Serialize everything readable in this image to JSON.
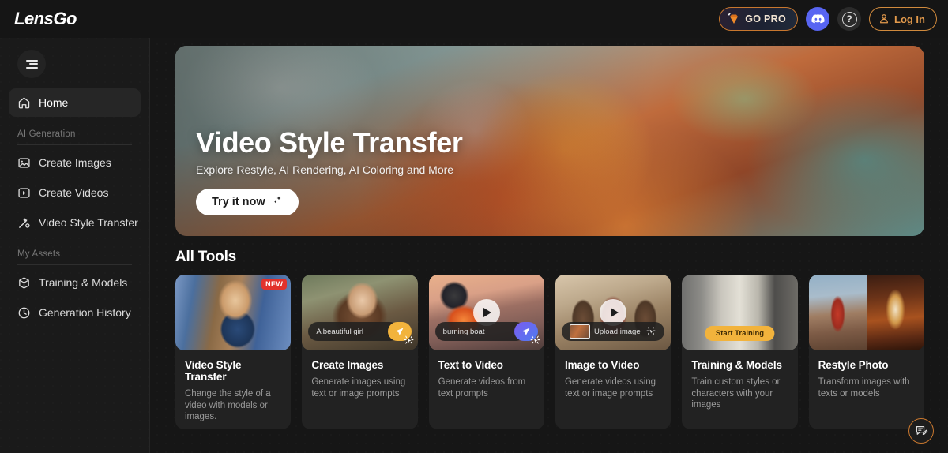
{
  "header": {
    "logo": "LensGo",
    "go_pro_label": "GO PRO",
    "login_label": "Log In",
    "discord_icon": "discord-icon",
    "help_icon": "question-mark-icon",
    "gem_icon": "diamond-gem-icon",
    "user_icon": "person-icon",
    "accent_orange": "#e39a4c",
    "discord_blue": "#5865f2"
  },
  "sidebar": {
    "menu_toggle_icon": "hamburger-menu-icon",
    "home": {
      "label": "Home",
      "icon": "home-icon",
      "active": true
    },
    "sections": [
      {
        "title": "AI Generation",
        "items": [
          {
            "label": "Create Images",
            "icon": "image-icon"
          },
          {
            "label": "Create Videos",
            "icon": "video-play-icon"
          },
          {
            "label": "Video Style Transfer",
            "icon": "magic-wand-icon"
          }
        ]
      },
      {
        "title": "My Assets",
        "items": [
          {
            "label": "Training & Models",
            "icon": "cube-icon"
          },
          {
            "label": "Generation History",
            "icon": "clock-icon"
          }
        ]
      }
    ]
  },
  "hero": {
    "title": "Video Style Transfer",
    "subtitle": "Explore Restyle, AI Rendering, AI Coloring and More",
    "cta_label": "Try it now",
    "cta_icon": "sparkle-icon"
  },
  "tools": {
    "heading": "All Tools",
    "cards": [
      {
        "title": "Video Style Transfer",
        "desc": "Change the style of a video with models or images.",
        "badge": "NEW",
        "thumb_class": "tn-vangogh",
        "overlay": "none"
      },
      {
        "title": "Create Images",
        "desc": "Generate images using text or image prompts",
        "badge": null,
        "thumb_class": "tn-girl",
        "overlay": "prompt",
        "prompt_text": "A beautiful girl",
        "send_color": "yellow"
      },
      {
        "title": "Text to Video",
        "desc": "Generate videos from text prompts",
        "badge": null,
        "thumb_class": "tn-boat",
        "overlay": "prompt-play",
        "prompt_text": "burning boat",
        "send_color": "purple"
      },
      {
        "title": "Image to Video",
        "desc": "Generate videos using text or image prompts",
        "badge": null,
        "thumb_class": "tn-cowboy",
        "overlay": "upload-play",
        "prompt_text": "Upload image"
      },
      {
        "title": "Training & Models",
        "desc": "Train custom styles or characters with your images",
        "badge": null,
        "thumb_class": "tn-statue",
        "overlay": "pill",
        "pill_text": "Start Training"
      },
      {
        "title": "Restyle Photo",
        "desc": "Transform images with texts or models",
        "badge": null,
        "thumb_class": "tn-restyle",
        "overlay": "split"
      }
    ]
  },
  "feedback": {
    "icon": "feedback-note-icon"
  }
}
